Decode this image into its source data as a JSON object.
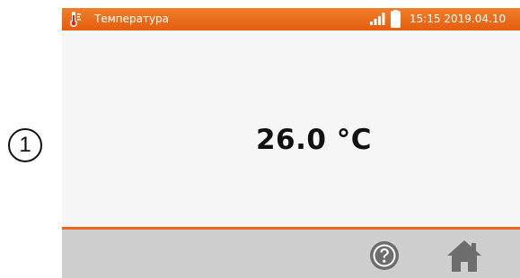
{
  "callout": {
    "number": "1"
  },
  "status_bar": {
    "title": "Температура",
    "datetime": "15:15 2019.04.10",
    "icons": [
      "thermometer-icon",
      "signal-icon",
      "battery-icon"
    ]
  },
  "reading": {
    "value": "26.0 °C"
  },
  "toolbar": {
    "icons": [
      "help-icon",
      "home-icon"
    ]
  },
  "colors": {
    "status_bar": "#e86a1e",
    "screen_background": "#f6f6f6",
    "toolbar_background": "#cfcfcf",
    "icon_gray": "#6d6d6d"
  }
}
